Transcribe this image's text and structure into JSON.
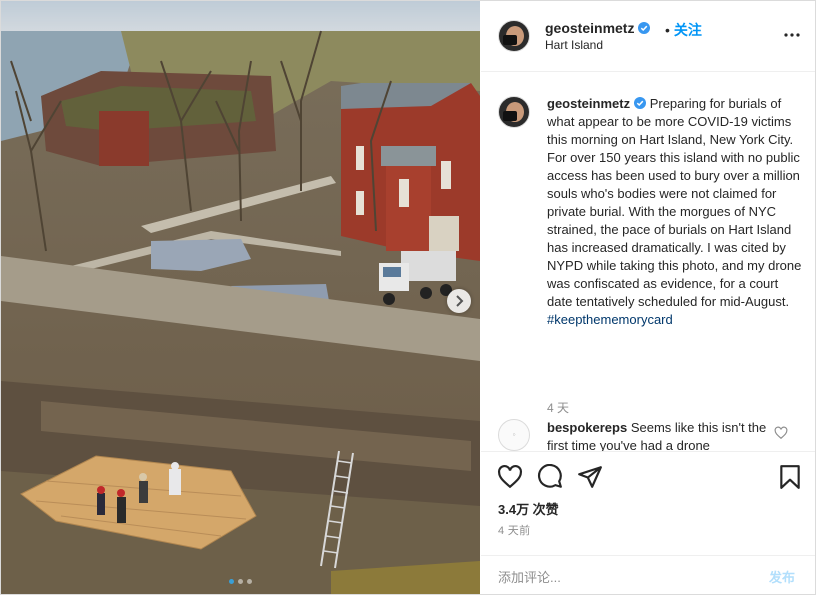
{
  "header": {
    "username": "geosteinmetz",
    "separator": "•",
    "follow_label": "关注",
    "location": "Hart Island"
  },
  "caption": {
    "username": "geosteinmetz",
    "text": "Preparing for burials of what appear to be more COVID-19 victims this morning on Hart Island, New York City. For over 150 years this island with no public access has been used to bury over a million souls who's bodies were not claimed for private burial. With the morgues of NYC strained, the pace of burials on Hart Island has increased dramatically. I was cited by NYPD while taking this photo, and my drone was confiscated as evidence, for a court date tentatively scheduled for mid-August.",
    "hashtag": "#keepthememorycard",
    "time": "4 天"
  },
  "comment": {
    "username": "bespokereps",
    "text": "Seems like this isn't the first time you've had a drone"
  },
  "actions": {
    "likes": "3.4万 次赞",
    "post_time": "4 天前"
  },
  "add_comment": {
    "placeholder": "添加评论...",
    "post_label": "发布"
  },
  "carousel": {
    "total_slides": 3,
    "active_slide": 1
  },
  "colors": {
    "accent": "#0095f6",
    "hashtag": "#00376b",
    "post_disabled": "#b2dffc",
    "verified": "#3897f0",
    "active_dot": "#3a9fd6"
  },
  "icons": [
    "more-options-icon",
    "verified-badge-icon",
    "heart-icon",
    "comment-icon",
    "share-icon",
    "bookmark-icon",
    "next-arrow-icon"
  ]
}
